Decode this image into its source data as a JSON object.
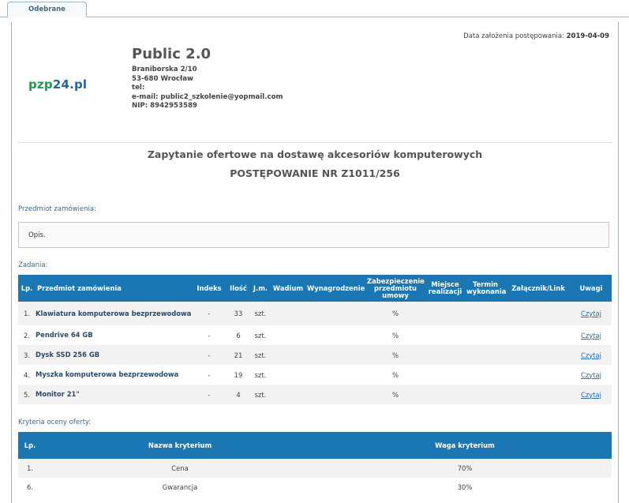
{
  "tab": {
    "label": "Odebrane"
  },
  "header": {
    "date_label": "Data założenia postępowania:",
    "date_value": "2019-04-09",
    "logo_main": "pzp",
    "logo_accent": "24.pl",
    "company_name": "Public 2.0",
    "address_street": "Braniborska 2/10",
    "address_city": "53-680 Wrocław",
    "tel": "tel:",
    "email": "e-mail: public2_szkolenie@yopmail.com",
    "nip": "NIP: 8942953589"
  },
  "title": {
    "line1": "Zapytanie ofertowe na dostawę akcesoriów komputerowych",
    "line2": "POSTĘPOWANIE NR Z1011/256"
  },
  "subject": {
    "label": "Przedmiot zamówienia:",
    "description": "Opis."
  },
  "tasks": {
    "label": "Zadania:",
    "columns": [
      "Lp.",
      "Przedmiot zamówienia",
      "Indeks",
      "Ilość",
      "J.m.",
      "Wadium",
      "Wynagrodzenie",
      "Zabezpieczenie przedmiotu umowy",
      "Miejsce realizacji",
      "Termin wykonania",
      "Załącznik/Link",
      "Uwagi"
    ],
    "rows": [
      {
        "lp": "1.",
        "name": "Klawiatura komputerowa bezprzewodowa",
        "index": "-",
        "qty": "33",
        "unit": "szt.",
        "security": "%",
        "note": "Czytaj"
      },
      {
        "lp": "2.",
        "name": "Pendrive 64 GB",
        "index": "-",
        "qty": "6",
        "unit": "szt.",
        "security": "%",
        "note": "Czytaj"
      },
      {
        "lp": "3.",
        "name": "Dysk SSD 256 GB",
        "index": "-",
        "qty": "21",
        "unit": "szt.",
        "security": "%",
        "note": "Czytaj"
      },
      {
        "lp": "4.",
        "name": "Myszka komputerowa bezprzewodowa",
        "index": "-",
        "qty": "19",
        "unit": "szt.",
        "security": "%",
        "note": "Czytaj"
      },
      {
        "lp": "5.",
        "name": "Monitor 21\"",
        "index": "-",
        "qty": "4",
        "unit": "szt.",
        "security": "%",
        "note": "Czytaj"
      }
    ]
  },
  "criteria": {
    "label": "Kryteria oceny oferty:",
    "columns": [
      "Lp.",
      "Nazwa kryterium",
      "Waga kryterium"
    ],
    "rows": [
      {
        "lp": "1.",
        "name": "Cena",
        "weight": "70%"
      },
      {
        "lp": "6.",
        "name": "Gwarancja",
        "weight": "30%"
      }
    ]
  },
  "colors": {
    "header_blue": "#1a77b3",
    "logo_green": "#1d9a4a",
    "link_blue": "#2a6fb0"
  }
}
